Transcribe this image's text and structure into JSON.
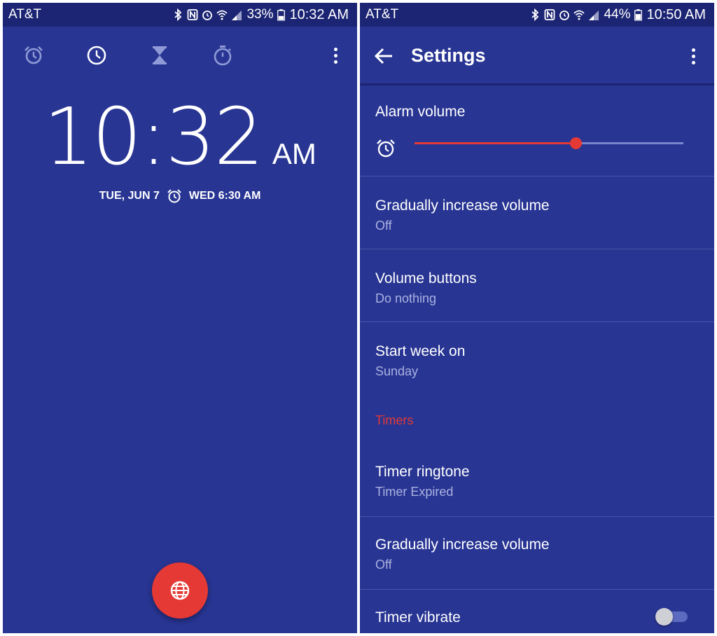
{
  "left": {
    "status": {
      "carrier": "AT&T",
      "battery": "33%",
      "time": "10:32 AM"
    },
    "tabs": [
      {
        "icon": "alarm-icon"
      },
      {
        "icon": "clock-icon"
      },
      {
        "icon": "hourglass-icon"
      },
      {
        "icon": "stopwatch-icon"
      }
    ],
    "clock": {
      "hm": "10:32",
      "ampm": "AM",
      "date": "TUE, JUN 7",
      "next_alarm": "WED 6:30 AM"
    },
    "fab": {
      "icon": "globe-icon"
    }
  },
  "right": {
    "status": {
      "carrier": "AT&T",
      "battery": "44%",
      "time": "10:50 AM"
    },
    "title": "Settings",
    "alarm_volume": {
      "title": "Alarm volume",
      "level": 0.6
    },
    "rows": [
      {
        "title": "Gradually increase volume",
        "value": "Off"
      },
      {
        "title": "Volume buttons",
        "value": "Do nothing"
      },
      {
        "title": "Start week on",
        "value": "Sunday"
      }
    ],
    "section": "Timers",
    "timer_rows": [
      {
        "title": "Timer ringtone",
        "value": "Timer Expired"
      },
      {
        "title": "Gradually increase volume",
        "value": "Off"
      }
    ],
    "vibrate": {
      "title": "Timer vibrate",
      "on": false
    }
  },
  "colors": {
    "primary": "#283593",
    "statusbar": "#1c2573",
    "accent": "#e53935",
    "subtext": "#aab2e0"
  }
}
